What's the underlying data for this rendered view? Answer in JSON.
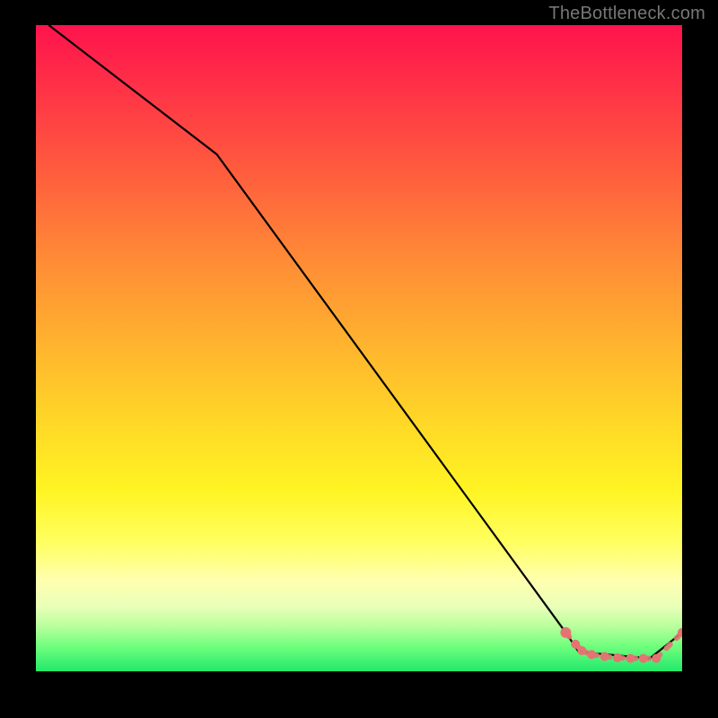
{
  "watermark": "TheBottleneck.com",
  "chart_data": {
    "type": "line",
    "title": "",
    "xlabel": "",
    "ylabel": "",
    "xlim": [
      0,
      100
    ],
    "ylim": [
      0,
      100
    ],
    "series": [
      {
        "name": "bottleneck-curve",
        "x": [
          2,
          28,
          82,
          84,
          95,
          100
        ],
        "y": [
          100,
          80,
          6,
          3,
          2,
          6
        ]
      }
    ],
    "markers": {
      "name": "highlight-points",
      "x": [
        82,
        83.5,
        84.5,
        86,
        88,
        90,
        92,
        94,
        96,
        100
      ],
      "y": [
        6,
        4.2,
        3.2,
        2.6,
        2.3,
        2.1,
        2.0,
        2.0,
        2.0,
        6
      ]
    }
  },
  "colors": {
    "marker": "#e57373",
    "line": "#000000"
  }
}
